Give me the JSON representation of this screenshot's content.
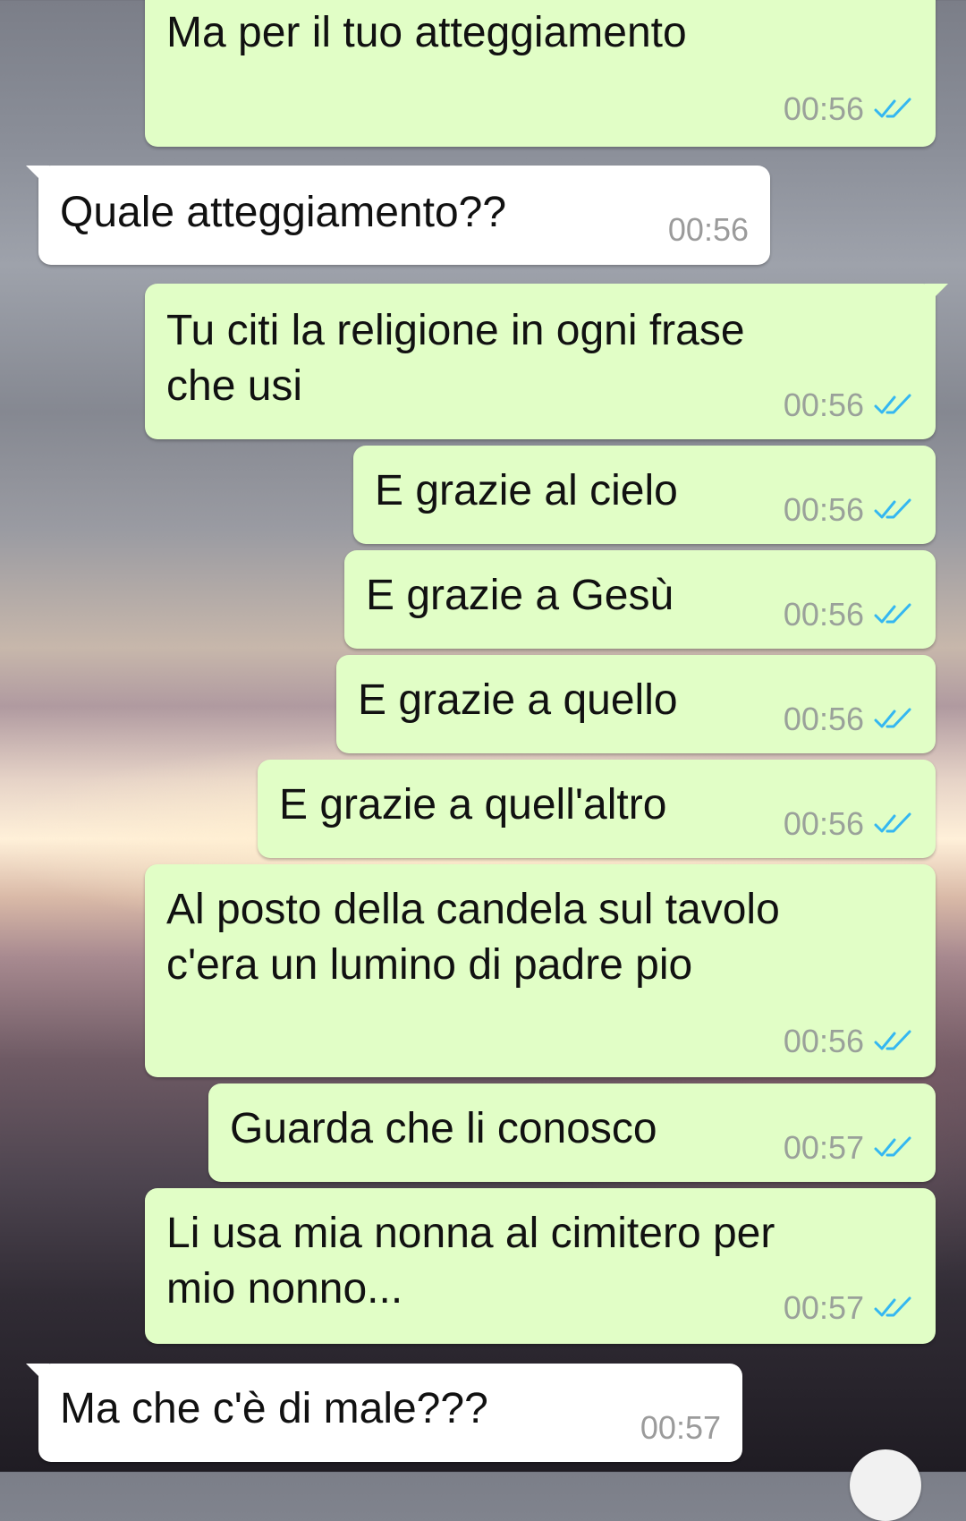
{
  "messages": [
    {
      "direction": "outgoing",
      "text": "Ma per il tuo atteggiamento",
      "time": "00:56",
      "status": "read"
    },
    {
      "direction": "incoming",
      "text": "Quale atteggiamento??",
      "time": "00:56"
    },
    {
      "direction": "outgoing",
      "lines": [
        "Tu citi la religione in ogni frase",
        "che usi"
      ],
      "time": "00:56",
      "status": "read"
    },
    {
      "direction": "outgoing",
      "text": "E grazie al cielo",
      "time": "00:56",
      "status": "read"
    },
    {
      "direction": "outgoing",
      "text": "E grazie a Gesù",
      "time": "00:56",
      "status": "read"
    },
    {
      "direction": "outgoing",
      "text": "E grazie a quello",
      "time": "00:56",
      "status": "read"
    },
    {
      "direction": "outgoing",
      "text": "E grazie a quell'altro",
      "time": "00:56",
      "status": "read"
    },
    {
      "direction": "outgoing",
      "lines": [
        "Al posto della candela sul tavolo",
        "c'era un lumino di padre pio"
      ],
      "time": "00:56",
      "status": "read"
    },
    {
      "direction": "outgoing",
      "text": "Guarda che li conosco",
      "time": "00:57",
      "status": "read"
    },
    {
      "direction": "outgoing",
      "lines": [
        "Li usa mia nonna al cimitero per",
        "mio nonno..."
      ],
      "time": "00:57",
      "status": "read"
    },
    {
      "direction": "incoming",
      "text": "Ma che c'è di male???",
      "time": "00:57"
    }
  ],
  "colors": {
    "outgoing_bubble": "#e1fec6",
    "incoming_bubble": "#ffffff",
    "read_ticks": "#34b7f1",
    "timestamp": "#9aa19a"
  },
  "icons": {
    "read_status": "double-check-icon",
    "scroll_button": "scroll-down-button"
  }
}
